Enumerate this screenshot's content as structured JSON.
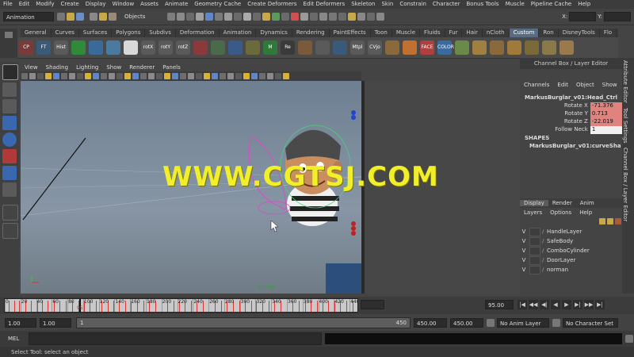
{
  "menubar": [
    "File",
    "Edit",
    "Modify",
    "Create",
    "Display",
    "Window",
    "Assets",
    "Animate",
    "Geometry Cache",
    "Create Deformers",
    "Edit Deformers",
    "Skeleton",
    "Skin",
    "Constrain",
    "Character",
    "Bonus Tools",
    "Muscle",
    "Pipeline Cache",
    "Help"
  ],
  "statusline": {
    "mode": "Animation",
    "select_mode": "Objects",
    "x_label": "X:",
    "y_label": "Y:"
  },
  "shelf_tabs": [
    "General",
    "Curves",
    "Surfaces",
    "Polygons",
    "Subdivs",
    "Deformation",
    "Animation",
    "Dynamics",
    "Rendering",
    "PaintEffects",
    "Toon",
    "Muscle",
    "Fluids",
    "Fur",
    "Hair",
    "nCloth",
    "Custom",
    "Ron",
    "DisneyTools",
    "Flo"
  ],
  "active_shelf_tab": "Custom",
  "shelf_items": [
    {
      "label": "CP",
      "color": "#7a3a3a"
    },
    {
      "label": "FT",
      "color": "#3a5a7a"
    },
    {
      "label": "Hist",
      "color": "#5a5a5a"
    },
    {
      "label": "",
      "color": "#2f8a3a"
    },
    {
      "label": "",
      "color": "#3a6a9a"
    },
    {
      "label": "",
      "color": "#4a7aa0"
    },
    {
      "label": "",
      "color": "#d8d8d8"
    },
    {
      "label": "rotX",
      "color": "#5a5a5a"
    },
    {
      "label": "rotY",
      "color": "#5a5a5a"
    },
    {
      "label": "rotZ",
      "color": "#5a5a5a"
    },
    {
      "label": "",
      "color": "#8a3a3a"
    },
    {
      "label": "",
      "color": "#4a6a4a"
    },
    {
      "label": "",
      "color": "#3a5a8a"
    },
    {
      "label": "",
      "color": "#6a6a3a"
    },
    {
      "label": "M",
      "color": "#2f7a3a"
    },
    {
      "label": "Re",
      "color": "#3a3a3a"
    },
    {
      "label": "",
      "color": "#7a5a3a"
    },
    {
      "label": "",
      "color": "#5a5a5a"
    },
    {
      "label": "",
      "color": "#3a5a7a"
    },
    {
      "label": "Mtpl",
      "color": "#5a5a5a"
    },
    {
      "label": "CVjo",
      "color": "#5a5a5a"
    },
    {
      "label": "",
      "color": "#8a6a3a"
    },
    {
      "label": "",
      "color": "#c07030"
    },
    {
      "label": "FACE",
      "color": "#b04040"
    },
    {
      "label": "COLOR",
      "color": "#3a6aa0"
    },
    {
      "label": "",
      "color": "#6a8a4a"
    },
    {
      "label": "",
      "color": "#a08040"
    },
    {
      "label": "",
      "color": "#8a6a3a"
    },
    {
      "label": "",
      "color": "#a07a3a"
    },
    {
      "label": "",
      "color": "#7a6a3a"
    },
    {
      "label": "",
      "color": "#8a7a4a"
    },
    {
      "label": "",
      "color": "#9a7a4a"
    }
  ],
  "panel_menu": [
    "View",
    "Shading",
    "Lighting",
    "Show",
    "Renderer",
    "Panels"
  ],
  "viewport": {
    "camera_label": "persp",
    "watermark": "WWW.CGTSJ.COM"
  },
  "channel_box": {
    "title": "Channel Box / Layer Editor",
    "menu": [
      "Channels",
      "Edit",
      "Object",
      "Show"
    ],
    "object_name": "MarkusBurglar_v01:Head_Ctrl",
    "attributes": [
      {
        "label": "Rotate X",
        "value": "-71.376",
        "highlight": true
      },
      {
        "label": "Rotate Y",
        "value": "0.713",
        "highlight": true
      },
      {
        "label": "Rotate Z",
        "value": "-22.019",
        "highlight": true
      },
      {
        "label": "Follow Neck",
        "value": "1",
        "highlight": false
      }
    ],
    "shapes_header": "SHAPES",
    "shape_name": "MarkusBurglar_v01:curveSha..."
  },
  "layer_editor": {
    "tabs": [
      "Display",
      "Render",
      "Anim"
    ],
    "menu": [
      "Layers",
      "Options",
      "Help"
    ],
    "layers": [
      {
        "visible": "V",
        "name": "HandleLayer"
      },
      {
        "visible": "V",
        "name": "SafeBody"
      },
      {
        "visible": "V",
        "name": "ComboCylinder"
      },
      {
        "visible": "V",
        "name": "DoorLayer"
      },
      {
        "visible": "V",
        "name": "norman"
      }
    ]
  },
  "side_tabs": [
    "Attribute Editor",
    "Tool Settings",
    "Channel Box / Layer Editor"
  ],
  "timeline": {
    "start": 0,
    "end": 450,
    "tick_labels": [
      "0",
      "20",
      "40",
      "60",
      "80",
      "100",
      "120",
      "140",
      "160",
      "180",
      "200",
      "220",
      "240",
      "260",
      "280",
      "300",
      "320",
      "340",
      "360",
      "380",
      "400",
      "420",
      "440"
    ],
    "current_frame": "95",
    "current_frame_field": "95.00",
    "keyframes": [
      5,
      12,
      18,
      26,
      33,
      41,
      48,
      55,
      63,
      70,
      78,
      86,
      94,
      101,
      108,
      116,
      123,
      131,
      139,
      146,
      154,
      161,
      169,
      177,
      184,
      192,
      200,
      207,
      215,
      222,
      230,
      238,
      245,
      253,
      260,
      268,
      276,
      283,
      291,
      299,
      306,
      314,
      321,
      329,
      337,
      344,
      352,
      360,
      367,
      375,
      383,
      390,
      398,
      405,
      413,
      421,
      428,
      436,
      444
    ]
  },
  "range": {
    "start_field": "1.00",
    "start_field2": "1.00",
    "slider_start": "1",
    "slider_end": "450",
    "end_field": "450.00",
    "end_field2": "450.00",
    "anim_layer": "No Anim Layer",
    "character_set": "No Character Set"
  },
  "command_line": {
    "label": "MEL"
  },
  "help_line": {
    "text": "Select Tool: select an object"
  },
  "playback_buttons": [
    "|◀",
    "◀◀",
    "◀|",
    "◀",
    "▶",
    "▶|",
    "▶▶",
    "▶|"
  ]
}
